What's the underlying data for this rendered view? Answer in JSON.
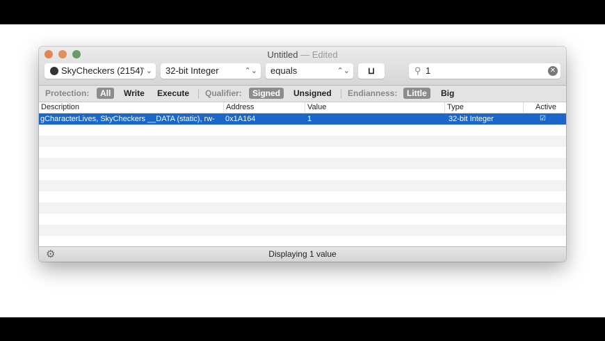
{
  "window": {
    "title": "Untitled",
    "edited": "— Edited"
  },
  "toolbar": {
    "process": "SkyCheckers (2154)",
    "type": "32-bit Integer",
    "operator": "equals",
    "store_button": "⊔",
    "search_value": "1"
  },
  "filters": {
    "protection_label": "Protection:",
    "protection": [
      "All",
      "Write",
      "Execute"
    ],
    "qualifier_label": "Qualifier:",
    "qualifier": [
      "Signed",
      "Unsigned"
    ],
    "endianness_label": "Endianness:",
    "endianness": [
      "Little",
      "Big"
    ]
  },
  "table": {
    "columns": [
      "Description",
      "Address",
      "Value",
      "Type",
      "Active"
    ],
    "rows": [
      {
        "description": "gCharacterLives, SkyCheckers __DATA (static), rw-",
        "address": "0x1A164",
        "value": "1",
        "type": "32-bit Integer",
        "active": true
      }
    ]
  },
  "status": "Displaying 1 value",
  "colors": {
    "selection": "#1b66c9",
    "close": "#e0855a",
    "minimize": "#e0905a",
    "zoom": "#6a9a6a"
  }
}
